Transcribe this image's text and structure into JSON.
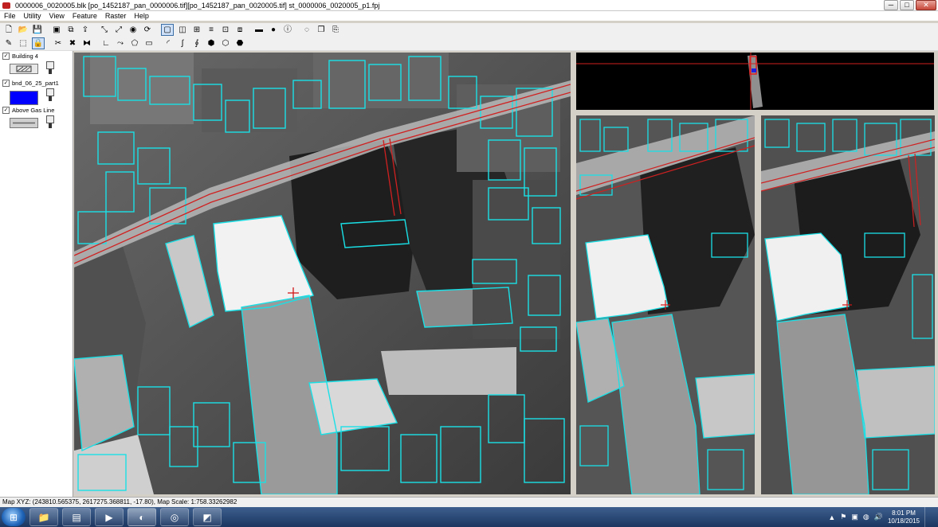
{
  "window": {
    "title": "0000006_0020005.blk [po_1452187_pan_0000006.tif][po_1452187_pan_0020005.tif]  st_0000006_0020005_p1.fpj",
    "minimize": "─",
    "maximize": "□",
    "close": "✕"
  },
  "menu": [
    "File",
    "Utility",
    "View",
    "Feature",
    "Raster",
    "Help"
  ],
  "toolbar1": [
    {
      "icon": "new-file-icon",
      "glyph": "🗋"
    },
    {
      "icon": "open-folder-icon",
      "glyph": "📂"
    },
    {
      "icon": "save-icon",
      "glyph": "💾"
    },
    {
      "icon": "book-icon",
      "glyph": "▣"
    },
    {
      "icon": "layers-icon",
      "glyph": "⧉"
    },
    {
      "icon": "export-icon",
      "glyph": "⇪"
    },
    {
      "icon": "fit-extent-icon",
      "glyph": "⤡"
    },
    {
      "icon": "zoom-extent-icon",
      "glyph": "⤢"
    },
    {
      "icon": "target-icon",
      "glyph": "◉"
    },
    {
      "icon": "sync-icon",
      "glyph": "⟳"
    },
    {
      "icon": "single-view-icon",
      "glyph": "▢"
    },
    {
      "icon": "split-view-icon",
      "glyph": "◫"
    },
    {
      "icon": "quad-view-icon",
      "glyph": "⊞"
    },
    {
      "icon": "stack-icon",
      "glyph": "≡"
    },
    {
      "icon": "grid-icon",
      "glyph": "⊡"
    },
    {
      "icon": "window-icon",
      "glyph": "⧈"
    },
    {
      "icon": "bar-icon",
      "glyph": "▬"
    },
    {
      "icon": "globe-icon",
      "glyph": "●"
    },
    {
      "icon": "info-icon",
      "glyph": "ⓘ"
    },
    {
      "icon": "circle-select-icon",
      "glyph": "◌"
    },
    {
      "icon": "copy-icon",
      "glyph": "❐"
    },
    {
      "icon": "paste-icon",
      "glyph": "⎘"
    }
  ],
  "toolbar2": [
    {
      "icon": "vertex-tool-icon",
      "glyph": "✎"
    },
    {
      "icon": "select-rect-icon",
      "glyph": "⬚"
    },
    {
      "icon": "lock-tool-icon",
      "glyph": "🔒"
    },
    {
      "icon": "cut-icon",
      "glyph": "✂"
    },
    {
      "icon": "delete-icon",
      "glyph": "✖"
    },
    {
      "icon": "merge-icon",
      "glyph": "⧓"
    },
    {
      "icon": "line-tool-icon",
      "glyph": "∟"
    },
    {
      "icon": "polyline-tool-icon",
      "glyph": "⤳"
    },
    {
      "icon": "polygon-tool-icon",
      "glyph": "⬠"
    },
    {
      "icon": "rectangle-tool-icon",
      "glyph": "▭"
    },
    {
      "icon": "arc-tool-icon",
      "glyph": "◜"
    },
    {
      "icon": "curve-tool-icon",
      "glyph": "∫"
    },
    {
      "icon": "snap-tool-icon",
      "glyph": "∮"
    },
    {
      "icon": "building-tool-icon",
      "glyph": "⬢"
    },
    {
      "icon": "extrude-tool-icon",
      "glyph": "⬡"
    },
    {
      "icon": "roof-tool-icon",
      "glyph": "⬣"
    }
  ],
  "layers": [
    {
      "name": "Building 4",
      "checked": "✓",
      "swatch_color": "#e8e8e8",
      "swatch_kind": "hatch"
    },
    {
      "name": "bnd_06_25_part1",
      "checked": "✓",
      "swatch_color": "#0000ff",
      "swatch_kind": "fill"
    },
    {
      "name": "Above Gas Line",
      "checked": "✓",
      "swatch_color": "#cfcfcf",
      "swatch_kind": "line"
    }
  ],
  "status": {
    "text": "Map XYZ: (243810.565375, 2617275.368811, -17.80), Map Scale: 1:758.33262982"
  },
  "taskbar": {
    "start_glyph": "⊞",
    "apps": [
      {
        "name": "file-explorer",
        "glyph": "📁",
        "active": false
      },
      {
        "name": "documents",
        "glyph": "▤",
        "active": false
      },
      {
        "name": "media-player",
        "glyph": "▶",
        "active": false
      },
      {
        "name": "stereo-app",
        "glyph": "◐",
        "active": true
      },
      {
        "name": "search-app",
        "glyph": "◎",
        "active": false
      },
      {
        "name": "mapping-app",
        "glyph": "◩",
        "active": false
      }
    ],
    "tray_icons": [
      "▲",
      "⚑",
      "▣",
      "◍",
      "🔊"
    ],
    "time": "8:01 PM",
    "date": "10/18/2015"
  },
  "colors": {
    "feature_outline": "#19e0e6",
    "gas_line": "#d02020",
    "cursor": "#d01818"
  }
}
